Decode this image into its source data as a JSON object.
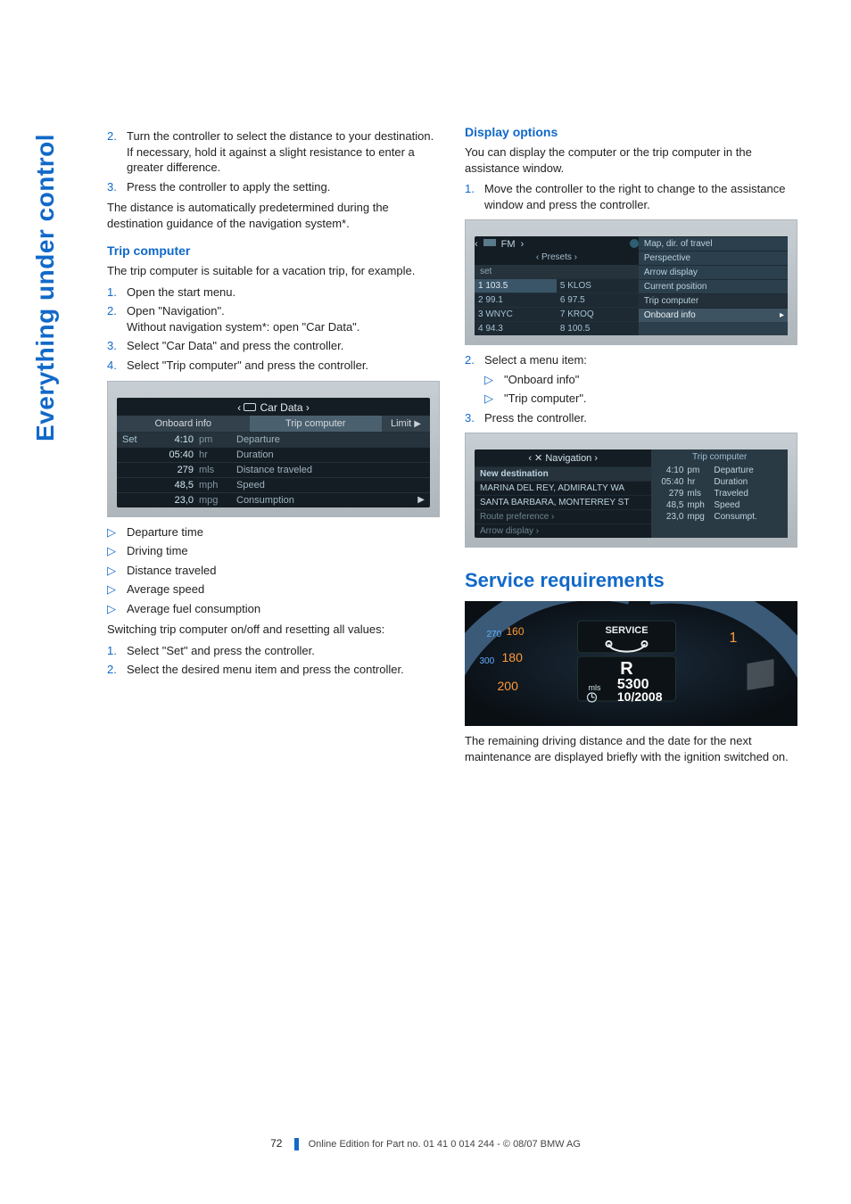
{
  "side_title": "Everything under control",
  "left": {
    "step2": "Turn the controller to select the distance to your destination. If necessary, hold it against a slight resistance to enter a greater difference.",
    "step3": "Press the controller to apply the setting.",
    "after_steps": "The distance is automatically predetermined during the destination guidance of the navigation system*.",
    "trip_heading": "Trip computer",
    "trip_intro": "The trip computer is suitable for a vacation trip, for example.",
    "tc1": "Open the start menu.",
    "tc2a": "Open \"Navigation\".",
    "tc2b": "Without navigation system*: open \"Car Data\".",
    "tc3": "Select \"Car Data\" and press the controller.",
    "tc4": "Select \"Trip computer\" and press the controller.",
    "idrive": {
      "title": "Car Data",
      "tab1": "Onboard info",
      "tab2": "Trip computer",
      "tab3": "Limit",
      "set": "Set",
      "rows": [
        {
          "v": "4:10",
          "u": "pm",
          "l": "Departure"
        },
        {
          "v": "05:40",
          "u": "hr",
          "l": "Duration"
        },
        {
          "v": "279",
          "u": "mls",
          "l": "Distance traveled"
        },
        {
          "v": "48,5",
          "u": "mph",
          "l": "Speed"
        },
        {
          "v": "23,0",
          "u": "mpg",
          "l": "Consumption"
        }
      ]
    },
    "bul1": "Departure time",
    "bul2": "Driving time",
    "bul3": "Distance traveled",
    "bul4": "Average speed",
    "bul5": "Average fuel consumption",
    "switching": "Switching trip computer on/off and resetting all values:",
    "sw1": "Select \"Set\" and press the controller.",
    "sw2": "Select the desired menu item and press the controller."
  },
  "right": {
    "disp_heading": "Display options",
    "disp_intro": "You can display the computer or the trip computer in the assistance window.",
    "d1": "Move the controller to the right to change to the assistance window and press the controller.",
    "radio": {
      "band": "FM",
      "presets": "‹ Presets ›",
      "set": "set",
      "cells": [
        "1 103.5",
        "5 KLOS",
        "2 99.1",
        "6 97.5",
        "3 WNYC",
        "7 KROQ",
        "4 94.3",
        "8 100.5"
      ],
      "menu": [
        "Map, dir. of travel",
        "Perspective",
        "Arrow display",
        "Current position",
        "Trip computer",
        "Onboard info"
      ]
    },
    "d2": "Select a menu item:",
    "d2a": "\"Onboard info\"",
    "d2b": "\"Trip computer\".",
    "d3": "Press the controller.",
    "nav": {
      "title": "Navigation",
      "right_title": "Trip computer",
      "newdest": "New destination",
      "dest1": "MARINA DEL REY, ADMIRALTY WA",
      "dest2": "SANTA BARBARA, MONTERREY ST",
      "route": "Route preference ›",
      "arrow": "Arrow display ›",
      "rows": [
        {
          "v": "4:10",
          "u": "pm",
          "l": "Departure"
        },
        {
          "v": "05:40",
          "u": "hr",
          "l": "Duration"
        },
        {
          "v": "279",
          "u": "mls",
          "l": "Traveled"
        },
        {
          "v": "48,5",
          "u": "mph",
          "l": "Speed"
        },
        {
          "v": "23,0",
          "u": "mpg",
          "l": "Consumpt."
        }
      ]
    },
    "service_heading": "Service requirements",
    "cluster": {
      "service": "SERVICE",
      "gear": "R",
      "unit": "mls",
      "miles": "5300",
      "date": "10/2008"
    },
    "service_text": "The remaining driving distance and the date for the next maintenance are displayed briefly with the ignition switched on."
  },
  "footer": {
    "page": "72",
    "text": "Online Edition for Part no. 01 41 0 014 244 - © 08/07 BMW AG"
  }
}
